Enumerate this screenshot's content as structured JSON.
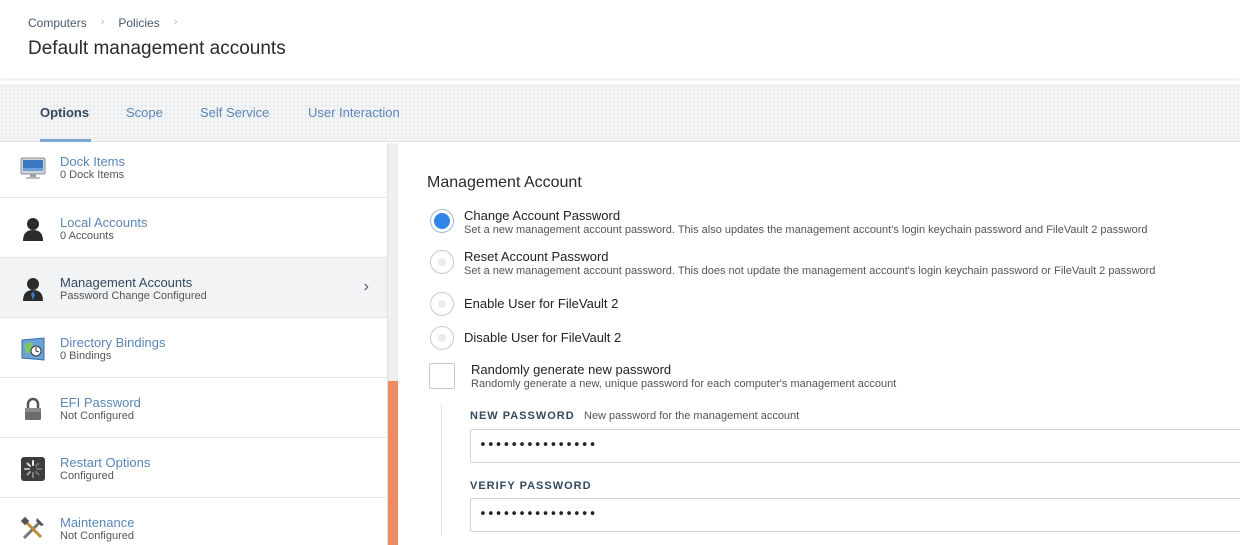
{
  "breadcrumb": {
    "items": [
      "Computers",
      "Policies"
    ],
    "separator": "›"
  },
  "page_title": "Default management accounts",
  "tabs": [
    {
      "label": "Options",
      "active": true
    },
    {
      "label": "Scope",
      "active": false
    },
    {
      "label": "Self Service",
      "active": false
    },
    {
      "label": "User Interaction",
      "active": false
    }
  ],
  "sidebar": {
    "items": [
      {
        "label": "Dock Items",
        "sub": "0 Dock Items",
        "icon": "monitor-icon"
      },
      {
        "label": "Local Accounts",
        "sub": "0 Accounts",
        "icon": "user-icon"
      },
      {
        "label": "Management Accounts",
        "sub": "Password Change Configured",
        "icon": "admin-user-icon",
        "selected": true,
        "chevron": "›"
      },
      {
        "label": "Directory Bindings",
        "sub": "0 Bindings",
        "icon": "directory-icon"
      },
      {
        "label": "EFI Password",
        "sub": "Not Configured",
        "icon": "lock-icon"
      },
      {
        "label": "Restart Options",
        "sub": "Configured",
        "icon": "restart-icon"
      },
      {
        "label": "Maintenance",
        "sub": "Not Configured",
        "icon": "tools-icon"
      }
    ]
  },
  "main": {
    "section_title": "Management Account",
    "options": [
      {
        "label": "Change Account Password",
        "desc": "Set a new management account password. This also updates the management account's login keychain password and FileVault 2 password",
        "checked": true
      },
      {
        "label": "Reset Account Password",
        "desc": "Set a new management account password. This does not update the management account's login keychain password or FileVault 2 password",
        "checked": false
      },
      {
        "label": "Enable User for FileVault 2",
        "desc": "",
        "checked": false
      },
      {
        "label": "Disable User for FileVault 2",
        "desc": "",
        "checked": false
      }
    ],
    "random_password": {
      "label": "Randomly generate new password",
      "desc": "Randomly generate a new, unique password for each computer's management account",
      "checked": false
    },
    "new_password": {
      "label": "NEW PASSWORD",
      "hint": "New password for the management account",
      "value": "•••••••••••••••"
    },
    "verify_password": {
      "label": "VERIFY PASSWORD",
      "value": "•••••••••••••••"
    }
  },
  "colors": {
    "accent": "#2f86e8",
    "link": "#5a86b8",
    "scroll_thumb": "#f28b62"
  }
}
